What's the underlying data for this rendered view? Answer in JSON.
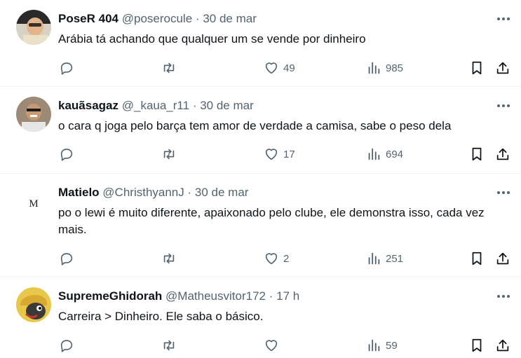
{
  "tweets": [
    {
      "name": "PoseR 404",
      "handle": "@poserocule",
      "dot": "·",
      "date": "30 de mar",
      "text": "Arábia tá achando que qualquer um se vende por dinheiro",
      "likes": "49",
      "views": "985",
      "avatar_bg": "#d9d2c4"
    },
    {
      "name": "kauãsagaz",
      "handle": "@_kaua_r11",
      "dot": "·",
      "date": "30 de mar",
      "text": "o cara q joga pelo barça tem amor de verdade a camisa, sabe o peso dela",
      "likes": "17",
      "views": "694",
      "avatar_bg": "#9c8a76"
    },
    {
      "name": "Matielo",
      "handle": "@ChristhyannJ",
      "dot": "·",
      "date": "30 de mar",
      "text": "po o lewi é muito diferente, apaixonado pelo clube, ele demonstra isso, cada vez mais.",
      "likes": "2",
      "views": "251",
      "avatar_letter": "M"
    },
    {
      "name": "SupremeGhidorah",
      "handle": "@Matheusvitor172",
      "dot": "·",
      "date": "17 h",
      "text": "Carreira > Dinheiro. Ele saba o básico.",
      "likes": "",
      "views": "59",
      "avatar_bg": "#e8c84a"
    }
  ],
  "colors": {
    "text": "#0f1419",
    "secondary": "#536471",
    "divider": "#eff3f4"
  }
}
